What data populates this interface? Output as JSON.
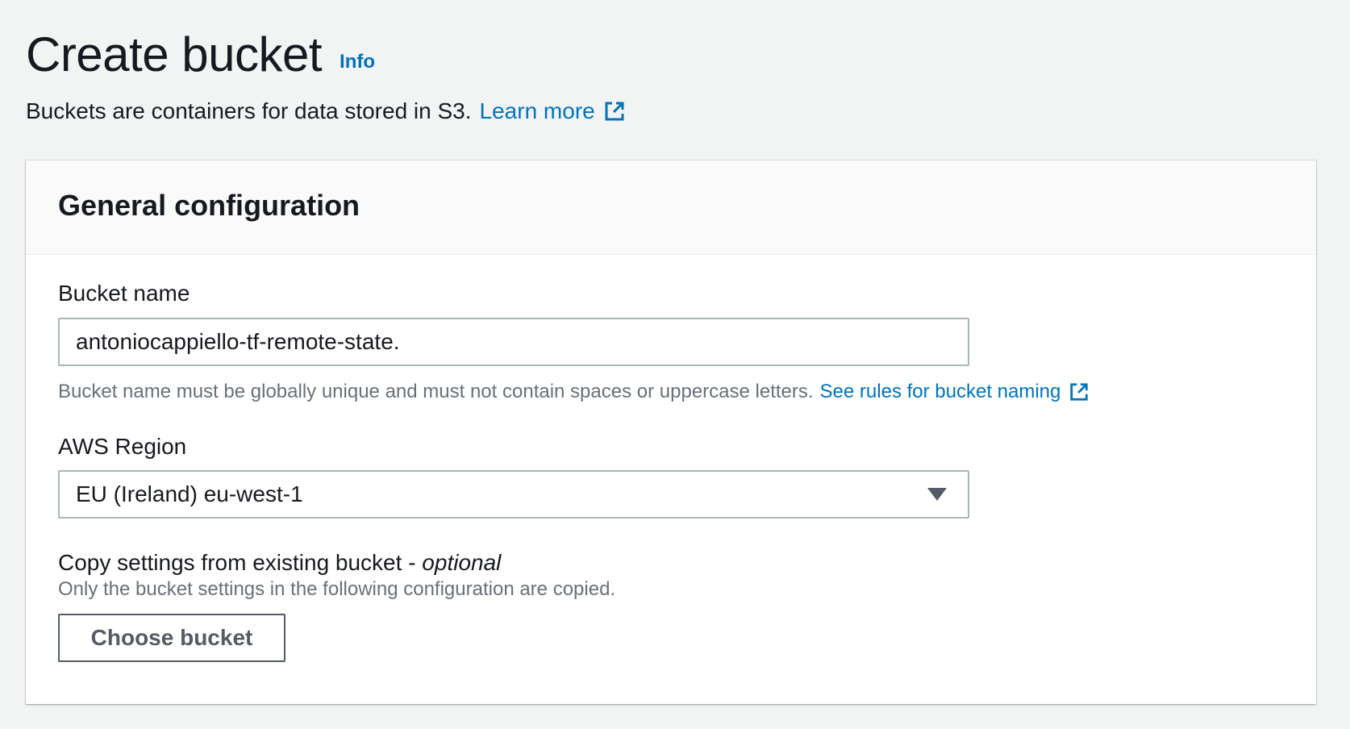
{
  "header": {
    "title": "Create bucket",
    "info_label": "Info",
    "description": "Buckets are containers for data stored in S3.",
    "learn_more_label": "Learn more"
  },
  "panel": {
    "title": "General configuration",
    "bucket_name": {
      "label": "Bucket name",
      "value": "antoniocappiello-tf-remote-state.",
      "hint": "Bucket name must be globally unique and must not contain spaces or uppercase letters.",
      "rules_link_label": "See rules for bucket naming"
    },
    "region": {
      "label": "AWS Region",
      "selected": "EU (Ireland) eu-west-1"
    },
    "copy_settings": {
      "label": "Copy settings from existing bucket - ",
      "optional_label": "optional",
      "hint": "Only the bucket settings in the following configuration are copied.",
      "button_label": "Choose bucket"
    }
  },
  "colors": {
    "link": "#0073bb",
    "background": "#f2f3f3",
    "panel_header": "#fafafa",
    "text": "#16191f",
    "hint_text": "#687078"
  },
  "icons": {
    "external_link": "external-link-icon",
    "dropdown": "caret-down-icon"
  }
}
